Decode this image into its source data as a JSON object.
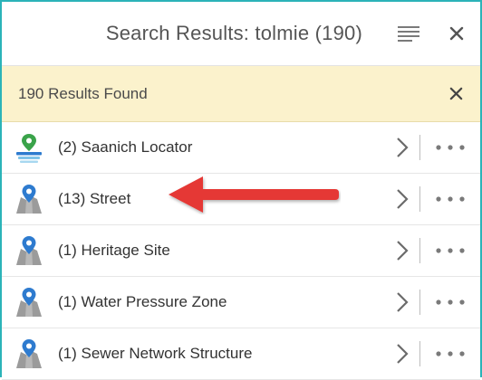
{
  "header": {
    "title": "Search Results: tolmie (190)",
    "menu_icon": "list-menu-icon",
    "close_icon": "close-icon"
  },
  "banner": {
    "text": "190 Results Found",
    "close_icon": "close-icon"
  },
  "results": [
    {
      "label": "(2) Saanich Locator",
      "icon": "locator-layers-icon"
    },
    {
      "label": "(13) Street",
      "icon": "map-pin-icon"
    },
    {
      "label": "(1) Heritage Site",
      "icon": "map-pin-icon"
    },
    {
      "label": "(1) Water Pressure Zone",
      "icon": "map-pin-icon"
    },
    {
      "label": "(1) Sewer Network Structure",
      "icon": "map-pin-icon"
    }
  ],
  "colors": {
    "accent_border": "#2bb3b8",
    "banner_bg": "#fbf2cc",
    "annotation_arrow": "#e53935",
    "pin_blue": "#2e7bcf",
    "locator_green": "#3aa34a"
  },
  "annotation": {
    "type": "red-arrow",
    "points_to": "(13) Street"
  }
}
